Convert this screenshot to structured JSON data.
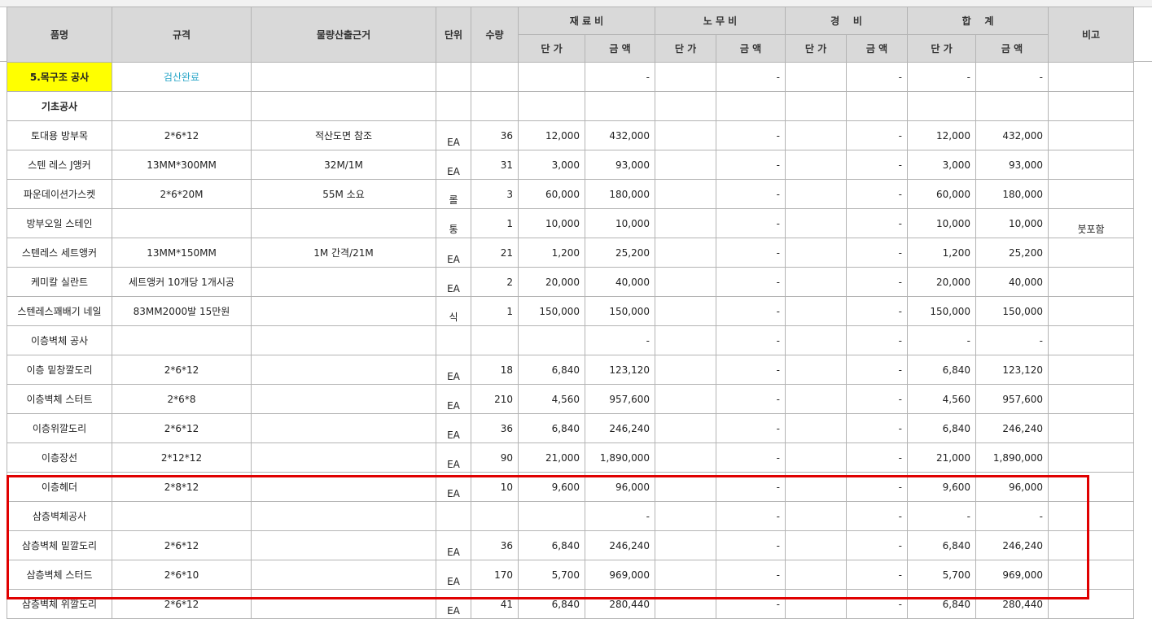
{
  "header": {
    "item": "품명",
    "spec": "규격",
    "basis": "물량산출근거",
    "unit": "단위",
    "qty": "수량",
    "material": "재 료 비",
    "labor": "노 무 비",
    "expense": "경    비",
    "total": "합    계",
    "note": "비고",
    "unit_price": "단 가",
    "amount": "금 액"
  },
  "rows": [
    {
      "item": "5.목구조 공사",
      "spec": "검산완료",
      "basis": "",
      "unit": "",
      "qty": "",
      "m_up": "",
      "m_amt": "-",
      "l_up": "",
      "l_amt": "-",
      "e_up": "",
      "e_amt": "-",
      "t_up": "-",
      "t_amt": "-",
      "note": "",
      "style": "section"
    },
    {
      "item": "기초공사",
      "spec": "",
      "basis": "",
      "unit": "",
      "qty": "",
      "m_up": "",
      "m_amt": "",
      "l_up": "",
      "l_amt": "",
      "e_up": "",
      "e_amt": "",
      "t_up": "",
      "t_amt": "",
      "note": "",
      "style": "group"
    },
    {
      "item": "토대용 방부목",
      "spec": "2*6*12",
      "basis": "적산도면 참조",
      "unit": "EA",
      "qty": "36",
      "m_up": "12,000",
      "m_amt": "432,000",
      "l_up": "",
      "l_amt": "-",
      "e_up": "",
      "e_amt": "-",
      "t_up": "12,000",
      "t_amt": "432,000",
      "note": ""
    },
    {
      "item": "스텐 레스 J앵커",
      "spec": "13MM*300MM",
      "basis": "32M/1M",
      "unit": "EA",
      "qty": "31",
      "m_up": "3,000",
      "m_amt": "93,000",
      "l_up": "",
      "l_amt": "-",
      "e_up": "",
      "e_amt": "-",
      "t_up": "3,000",
      "t_amt": "93,000",
      "note": ""
    },
    {
      "item": "파운데이션가스켓",
      "spec": "2*6*20M",
      "basis": "55M 소요",
      "unit": "롤",
      "qty": "3",
      "m_up": "60,000",
      "m_amt": "180,000",
      "l_up": "",
      "l_amt": "-",
      "e_up": "",
      "e_amt": "-",
      "t_up": "60,000",
      "t_amt": "180,000",
      "note": ""
    },
    {
      "item": "방부오일 스테인",
      "spec": "",
      "basis": "",
      "unit": "통",
      "qty": "1",
      "m_up": "10,000",
      "m_amt": "10,000",
      "l_up": "",
      "l_amt": "-",
      "e_up": "",
      "e_amt": "-",
      "t_up": "10,000",
      "t_amt": "10,000",
      "note": "붓포함"
    },
    {
      "item": "스텐레스 세트앵커",
      "spec": "13MM*150MM",
      "basis": "1M 간격/21M",
      "unit": "EA",
      "qty": "21",
      "m_up": "1,200",
      "m_amt": "25,200",
      "l_up": "",
      "l_amt": "-",
      "e_up": "",
      "e_amt": "-",
      "t_up": "1,200",
      "t_amt": "25,200",
      "note": ""
    },
    {
      "item": "케미칼 실란트",
      "spec": "세트앵커  10개당  1개시공",
      "basis": "",
      "unit": "EA",
      "qty": "2",
      "m_up": "20,000",
      "m_amt": "40,000",
      "l_up": "",
      "l_amt": "-",
      "e_up": "",
      "e_amt": "-",
      "t_up": "20,000",
      "t_amt": "40,000",
      "note": ""
    },
    {
      "item": "스텐레스꽤배기 네일",
      "spec": "83MM2000발 15만원",
      "basis": "",
      "unit": "식",
      "qty": "1",
      "m_up": "150,000",
      "m_amt": "150,000",
      "l_up": "",
      "l_amt": "-",
      "e_up": "",
      "e_amt": "-",
      "t_up": "150,000",
      "t_amt": "150,000",
      "note": ""
    },
    {
      "item": "이층벽체 공사",
      "spec": "",
      "basis": "",
      "unit": "",
      "qty": "",
      "m_up": "",
      "m_amt": "-",
      "l_up": "",
      "l_amt": "-",
      "e_up": "",
      "e_amt": "-",
      "t_up": "-",
      "t_amt": "-",
      "note": ""
    },
    {
      "item": "이층 밑창깔도리",
      "spec": "2*6*12",
      "basis": "",
      "unit": "EA",
      "qty": "18",
      "m_up": "6,840",
      "m_amt": "123,120",
      "l_up": "",
      "l_amt": "-",
      "e_up": "",
      "e_amt": "-",
      "t_up": "6,840",
      "t_amt": "123,120",
      "note": ""
    },
    {
      "item": "이층벽체 스터트",
      "spec": "2*6*8",
      "basis": "",
      "unit": "EA",
      "qty": "210",
      "m_up": "4,560",
      "m_amt": "957,600",
      "l_up": "",
      "l_amt": "-",
      "e_up": "",
      "e_amt": "-",
      "t_up": "4,560",
      "t_amt": "957,600",
      "note": ""
    },
    {
      "item": "이층위깔도리",
      "spec": "2*6*12",
      "basis": "",
      "unit": "EA",
      "qty": "36",
      "m_up": "6,840",
      "m_amt": "246,240",
      "l_up": "",
      "l_amt": "-",
      "e_up": "",
      "e_amt": "-",
      "t_up": "6,840",
      "t_amt": "246,240",
      "note": ""
    },
    {
      "item": "이층장선",
      "spec": "2*12*12",
      "basis": "",
      "unit": "EA",
      "qty": "90",
      "m_up": "21,000",
      "m_amt": "1,890,000",
      "l_up": "",
      "l_amt": "-",
      "e_up": "",
      "e_amt": "-",
      "t_up": "21,000",
      "t_amt": "1,890,000",
      "note": ""
    },
    {
      "item": "이층헤더",
      "spec": "2*8*12",
      "basis": "",
      "unit": "EA",
      "qty": "10",
      "m_up": "9,600",
      "m_amt": "96,000",
      "l_up": "",
      "l_amt": "-",
      "e_up": "",
      "e_amt": "-",
      "t_up": "9,600",
      "t_amt": "96,000",
      "note": ""
    },
    {
      "item": "삼층벽체공사",
      "spec": "",
      "basis": "",
      "unit": "",
      "qty": "",
      "m_up": "",
      "m_amt": "-",
      "l_up": "",
      "l_amt": "-",
      "e_up": "",
      "e_amt": "-",
      "t_up": "-",
      "t_amt": "-",
      "note": ""
    },
    {
      "item": "삼층벽체 밑깔도리",
      "spec": "2*6*12",
      "basis": "",
      "unit": "EA",
      "qty": "36",
      "m_up": "6,840",
      "m_amt": "246,240",
      "l_up": "",
      "l_amt": "-",
      "e_up": "",
      "e_amt": "-",
      "t_up": "6,840",
      "t_amt": "246,240",
      "note": ""
    },
    {
      "item": "삼층벽체 스터드",
      "spec": "2*6*10",
      "basis": "",
      "unit": "EA",
      "qty": "170",
      "m_up": "5,700",
      "m_amt": "969,000",
      "l_up": "",
      "l_amt": "-",
      "e_up": "",
      "e_amt": "-",
      "t_up": "5,700",
      "t_amt": "969,000",
      "note": ""
    },
    {
      "item": "삼층벽체 위깔도리",
      "spec": "2*6*12",
      "basis": "",
      "unit": "EA",
      "qty": "41",
      "m_up": "6,840",
      "m_amt": "280,440",
      "l_up": "",
      "l_amt": "-",
      "e_up": "",
      "e_amt": "-",
      "t_up": "6,840",
      "t_amt": "280,440",
      "note": ""
    }
  ],
  "colors": {
    "highlight_box": "#e00000",
    "section_fill": "#ffff00",
    "check_text": "#2aa6c8",
    "header_fill": "#d9d9d9"
  }
}
